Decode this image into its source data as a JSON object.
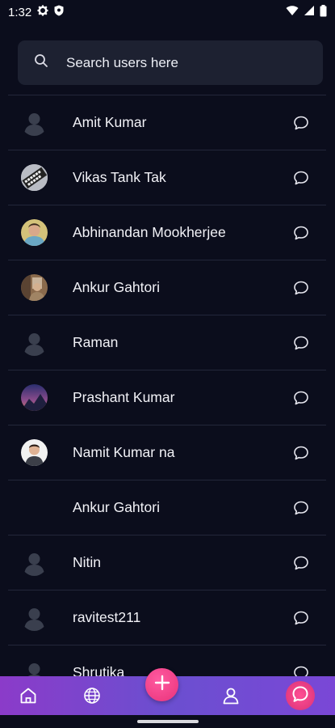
{
  "status_bar": {
    "time": "1:32",
    "icons": [
      "settings-icon",
      "shield-icon",
      "wifi-icon",
      "signal-icon",
      "battery-icon"
    ]
  },
  "search": {
    "placeholder": "Search users here"
  },
  "users": [
    {
      "name": "Amit Kumar",
      "avatar": "default-avatar"
    },
    {
      "name": "Vikas Tank Tak",
      "avatar": "photo-avatar"
    },
    {
      "name": "Abhinandan Mookherjee",
      "avatar": "photo-avatar"
    },
    {
      "name": "Ankur Gahtori",
      "avatar": "photo-avatar"
    },
    {
      "name": "Raman",
      "avatar": "default-avatar"
    },
    {
      "name": "Prashant Kumar",
      "avatar": "photo-avatar"
    },
    {
      "name": "Namit Kumar na",
      "avatar": "photo-avatar"
    },
    {
      "name": "Ankur Gahtori",
      "avatar": "none"
    },
    {
      "name": "Nitin",
      "avatar": "default-avatar"
    },
    {
      "name": "ravitest211",
      "avatar": "default-avatar"
    },
    {
      "name": "Shrutika",
      "avatar": "default-avatar"
    }
  ],
  "bottom_nav": {
    "items": [
      "home-icon",
      "globe-icon",
      "add-icon",
      "profile-icon",
      "chat-icon"
    ],
    "active": "chat-icon"
  },
  "colors": {
    "background": "#0b0d1c",
    "search_bg": "#1d2131",
    "divider": "#23273a",
    "nav_gradient_start": "#8b3bc9",
    "nav_gradient_end": "#7a47d6",
    "accent_pink": "#e8327a"
  }
}
